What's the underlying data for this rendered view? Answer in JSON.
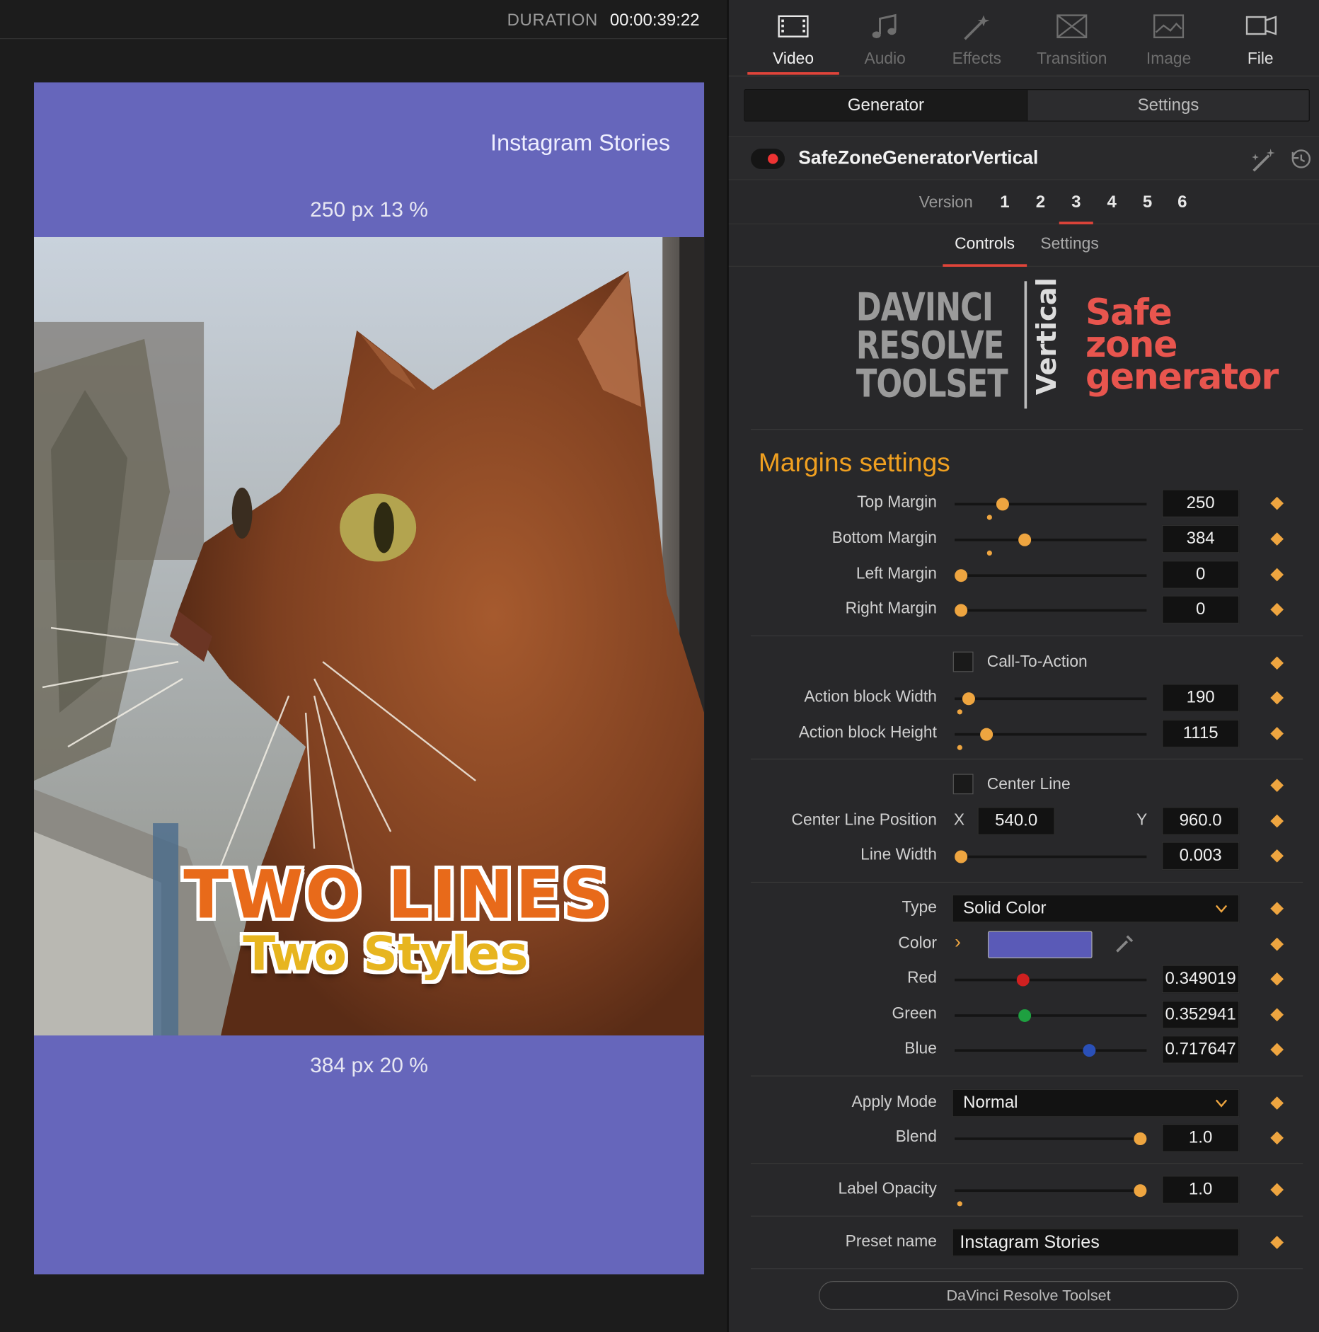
{
  "viewer": {
    "duration_label": "DURATION",
    "duration_value": "00:00:39:22",
    "preset_label": "Instagram Stories",
    "top_info": "250 px 13 %",
    "bottom_info": "384 px 20 %",
    "overlay_line1": "TWO LINES",
    "overlay_line2": "Two Styles"
  },
  "tabs": [
    {
      "label": "Video",
      "icon": "film-icon",
      "active": true
    },
    {
      "label": "Audio",
      "icon": "music-note-icon"
    },
    {
      "label": "Effects",
      "icon": "magic-wand-icon"
    },
    {
      "label": "Transition",
      "icon": "transition-icon"
    },
    {
      "label": "Image",
      "icon": "image-icon"
    },
    {
      "label": "File",
      "icon": "file-icon"
    }
  ],
  "segment": {
    "generator": "Generator",
    "settings": "Settings"
  },
  "header": {
    "title": "SafeZoneGeneratorVertical",
    "enabled": true
  },
  "version": {
    "label": "Version",
    "numbers": [
      "1",
      "2",
      "3",
      "4",
      "5",
      "6"
    ],
    "selected": "3"
  },
  "subtabs": {
    "controls": "Controls",
    "settings": "Settings"
  },
  "logo": {
    "line1": "DAVINCI",
    "line2": "RESOLVE",
    "line3": "TOOLSET",
    "vertical": "Vertical",
    "title1": "Safe",
    "title2": "zone",
    "title3": "generator"
  },
  "section_title": "Margins settings",
  "controls": {
    "top_margin": {
      "label": "Top Margin",
      "value": "250"
    },
    "bottom_margin": {
      "label": "Bottom Margin",
      "value": "384"
    },
    "left_margin": {
      "label": "Left Margin",
      "value": "0"
    },
    "right_margin": {
      "label": "Right Margin",
      "value": "0"
    },
    "call_to_action": {
      "label": "Call-To-Action",
      "checked": false
    },
    "action_width": {
      "label": "Action block Width",
      "value": "190"
    },
    "action_height": {
      "label": "Action block Height",
      "value": "1115"
    },
    "center_line": {
      "label": "Center Line",
      "checked": false
    },
    "center_pos": {
      "label": "Center Line Position",
      "x_label": "X",
      "x": "540.0",
      "y_label": "Y",
      "y": "960.0"
    },
    "line_width": {
      "label": "Line Width",
      "value": "0.003"
    },
    "type": {
      "label": "Type",
      "value": "Solid Color"
    },
    "color": {
      "label": "Color",
      "swatch": "#5a5ab7"
    },
    "red": {
      "label": "Red",
      "value": "0.349019"
    },
    "green": {
      "label": "Green",
      "value": "0.352941"
    },
    "blue": {
      "label": "Blue",
      "value": "0.717647"
    },
    "apply_mode": {
      "label": "Apply Mode",
      "value": "Normal"
    },
    "blend": {
      "label": "Blend",
      "value": "1.0"
    },
    "label_opacity": {
      "label": "Label Opacity",
      "value": "1.0"
    },
    "preset_name": {
      "label": "Preset name",
      "value": "Instagram Stories"
    }
  },
  "footer_button": "DaVinci Resolve Toolset",
  "colors": {
    "accent": "#e0443a",
    "keyframe": "#eea540",
    "section": "#f0a020",
    "frame": "#6666bb"
  }
}
